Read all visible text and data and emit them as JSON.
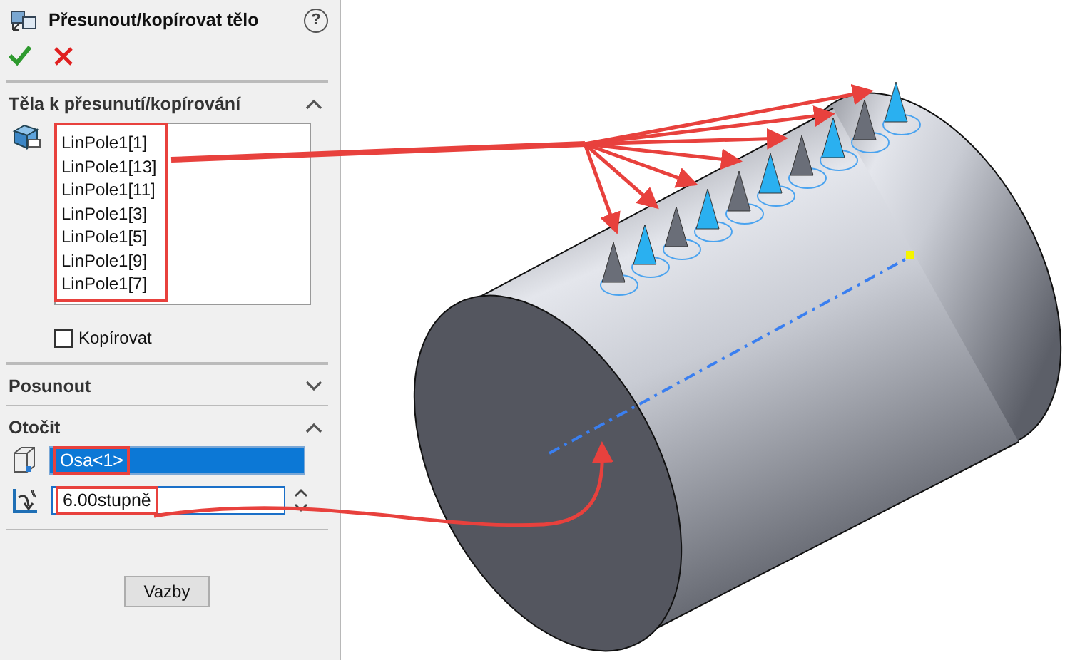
{
  "title": "Přesunout/kopírovat tělo",
  "help": "?",
  "sections": [
    {
      "kind": "bodies",
      "title": "Těla k přesunutí/kopírování",
      "expanded": true,
      "items": [
        "LinPole1[1]",
        "LinPole1[13]",
        "LinPole1[11]",
        "LinPole1[3]",
        "LinPole1[5]",
        "LinPole1[9]",
        "LinPole1[7]"
      ],
      "copy": {
        "label": "Kopírovat",
        "checked": false
      }
    },
    {
      "title": "Posunout",
      "expanded": false
    },
    {
      "kind": "rotate",
      "title": "Otočit",
      "expanded": true,
      "axis": {
        "value": "Osa<1>",
        "selected": true
      },
      "angle": {
        "value": "6.00stupně"
      }
    }
  ],
  "buttons": [
    {
      "label": "Vazby"
    }
  ]
}
